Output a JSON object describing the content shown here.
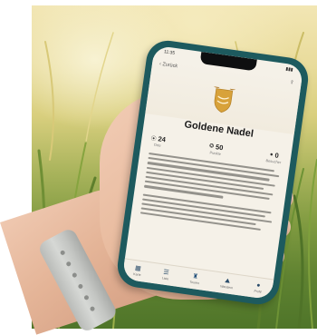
{
  "screen": {
    "status_time": "11:35",
    "back_label": "Zurück",
    "title": "Goldene Nadel",
    "stats": [
      {
        "icon": "location-pin-icon",
        "value": "24",
        "label": "Orte"
      },
      {
        "icon": "star-badge-icon",
        "value": "50",
        "label": "Punkte"
      },
      {
        "icon": "person-icon",
        "value": "0",
        "label": "Besucher"
      }
    ],
    "tabs": [
      {
        "icon": "map-icon",
        "label": "Karte"
      },
      {
        "icon": "list-icon",
        "label": "Liste"
      },
      {
        "icon": "castle-icon",
        "label": "Touren"
      },
      {
        "icon": "hiker-icon",
        "label": "Wandern"
      },
      {
        "icon": "profile-icon",
        "label": "Profil"
      }
    ],
    "accent": "#c9922e",
    "case_color": "#1d5a5e"
  }
}
